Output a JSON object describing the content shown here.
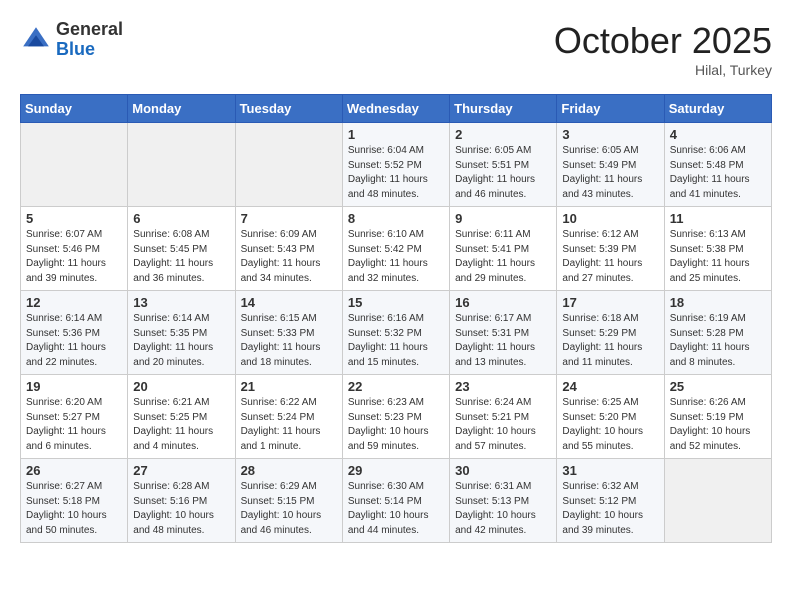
{
  "header": {
    "logo_line1": "General",
    "logo_line2": "Blue",
    "month": "October 2025",
    "location": "Hilal, Turkey"
  },
  "weekdays": [
    "Sunday",
    "Monday",
    "Tuesday",
    "Wednesday",
    "Thursday",
    "Friday",
    "Saturday"
  ],
  "weeks": [
    [
      {
        "day": "",
        "info": ""
      },
      {
        "day": "",
        "info": ""
      },
      {
        "day": "",
        "info": ""
      },
      {
        "day": "1",
        "info": "Sunrise: 6:04 AM\nSunset: 5:52 PM\nDaylight: 11 hours\nand 48 minutes."
      },
      {
        "day": "2",
        "info": "Sunrise: 6:05 AM\nSunset: 5:51 PM\nDaylight: 11 hours\nand 46 minutes."
      },
      {
        "day": "3",
        "info": "Sunrise: 6:05 AM\nSunset: 5:49 PM\nDaylight: 11 hours\nand 43 minutes."
      },
      {
        "day": "4",
        "info": "Sunrise: 6:06 AM\nSunset: 5:48 PM\nDaylight: 11 hours\nand 41 minutes."
      }
    ],
    [
      {
        "day": "5",
        "info": "Sunrise: 6:07 AM\nSunset: 5:46 PM\nDaylight: 11 hours\nand 39 minutes."
      },
      {
        "day": "6",
        "info": "Sunrise: 6:08 AM\nSunset: 5:45 PM\nDaylight: 11 hours\nand 36 minutes."
      },
      {
        "day": "7",
        "info": "Sunrise: 6:09 AM\nSunset: 5:43 PM\nDaylight: 11 hours\nand 34 minutes."
      },
      {
        "day": "8",
        "info": "Sunrise: 6:10 AM\nSunset: 5:42 PM\nDaylight: 11 hours\nand 32 minutes."
      },
      {
        "day": "9",
        "info": "Sunrise: 6:11 AM\nSunset: 5:41 PM\nDaylight: 11 hours\nand 29 minutes."
      },
      {
        "day": "10",
        "info": "Sunrise: 6:12 AM\nSunset: 5:39 PM\nDaylight: 11 hours\nand 27 minutes."
      },
      {
        "day": "11",
        "info": "Sunrise: 6:13 AM\nSunset: 5:38 PM\nDaylight: 11 hours\nand 25 minutes."
      }
    ],
    [
      {
        "day": "12",
        "info": "Sunrise: 6:14 AM\nSunset: 5:36 PM\nDaylight: 11 hours\nand 22 minutes."
      },
      {
        "day": "13",
        "info": "Sunrise: 6:14 AM\nSunset: 5:35 PM\nDaylight: 11 hours\nand 20 minutes."
      },
      {
        "day": "14",
        "info": "Sunrise: 6:15 AM\nSunset: 5:33 PM\nDaylight: 11 hours\nand 18 minutes."
      },
      {
        "day": "15",
        "info": "Sunrise: 6:16 AM\nSunset: 5:32 PM\nDaylight: 11 hours\nand 15 minutes."
      },
      {
        "day": "16",
        "info": "Sunrise: 6:17 AM\nSunset: 5:31 PM\nDaylight: 11 hours\nand 13 minutes."
      },
      {
        "day": "17",
        "info": "Sunrise: 6:18 AM\nSunset: 5:29 PM\nDaylight: 11 hours\nand 11 minutes."
      },
      {
        "day": "18",
        "info": "Sunrise: 6:19 AM\nSunset: 5:28 PM\nDaylight: 11 hours\nand 8 minutes."
      }
    ],
    [
      {
        "day": "19",
        "info": "Sunrise: 6:20 AM\nSunset: 5:27 PM\nDaylight: 11 hours\nand 6 minutes."
      },
      {
        "day": "20",
        "info": "Sunrise: 6:21 AM\nSunset: 5:25 PM\nDaylight: 11 hours\nand 4 minutes."
      },
      {
        "day": "21",
        "info": "Sunrise: 6:22 AM\nSunset: 5:24 PM\nDaylight: 11 hours\nand 1 minute."
      },
      {
        "day": "22",
        "info": "Sunrise: 6:23 AM\nSunset: 5:23 PM\nDaylight: 10 hours\nand 59 minutes."
      },
      {
        "day": "23",
        "info": "Sunrise: 6:24 AM\nSunset: 5:21 PM\nDaylight: 10 hours\nand 57 minutes."
      },
      {
        "day": "24",
        "info": "Sunrise: 6:25 AM\nSunset: 5:20 PM\nDaylight: 10 hours\nand 55 minutes."
      },
      {
        "day": "25",
        "info": "Sunrise: 6:26 AM\nSunset: 5:19 PM\nDaylight: 10 hours\nand 52 minutes."
      }
    ],
    [
      {
        "day": "26",
        "info": "Sunrise: 6:27 AM\nSunset: 5:18 PM\nDaylight: 10 hours\nand 50 minutes."
      },
      {
        "day": "27",
        "info": "Sunrise: 6:28 AM\nSunset: 5:16 PM\nDaylight: 10 hours\nand 48 minutes."
      },
      {
        "day": "28",
        "info": "Sunrise: 6:29 AM\nSunset: 5:15 PM\nDaylight: 10 hours\nand 46 minutes."
      },
      {
        "day": "29",
        "info": "Sunrise: 6:30 AM\nSunset: 5:14 PM\nDaylight: 10 hours\nand 44 minutes."
      },
      {
        "day": "30",
        "info": "Sunrise: 6:31 AM\nSunset: 5:13 PM\nDaylight: 10 hours\nand 42 minutes."
      },
      {
        "day": "31",
        "info": "Sunrise: 6:32 AM\nSunset: 5:12 PM\nDaylight: 10 hours\nand 39 minutes."
      },
      {
        "day": "",
        "info": ""
      }
    ]
  ]
}
